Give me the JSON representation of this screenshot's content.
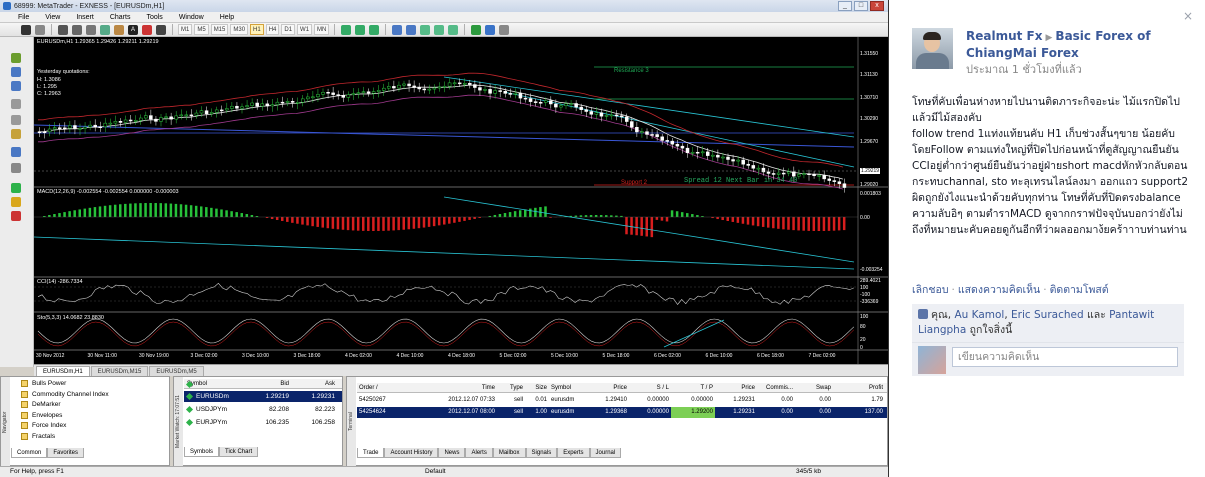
{
  "mt": {
    "title": "68999: MetaTrader - EXNESS - [EURUSDm,H1]",
    "menu": [
      "File",
      "View",
      "Insert",
      "Charts",
      "Tools",
      "Window",
      "Help"
    ],
    "timeframes": [
      "M1",
      "M5",
      "M15",
      "M30",
      "H1",
      "H4",
      "D1",
      "W1",
      "MN"
    ],
    "active_timeframe": "H1",
    "chart": {
      "header": "EURUSDm,H1  1.29365 1.29426 1.29211 1.29219",
      "yesterday": [
        "Yesterday quotations:",
        "H: 1.3086",
        "L: 1.295",
        "C: 1.2963"
      ],
      "price_labels": [
        "1.31550",
        "1.31130",
        "1.30710",
        "1.30290",
        "1.29670",
        "1.29219",
        "1.29020"
      ],
      "current_price": "1.29219",
      "labels": {
        "resistance": "Resistance 3",
        "support": "Support 2",
        "spread": "Spread  12  Next Bar in 34 40"
      },
      "macd_header": "MACD(12,26,9) -0.002554 -0.002554 0.000000 -0.000003",
      "macd_labels": [
        "0.001803",
        "0.00",
        "-0.003254"
      ],
      "cci_header": "CCI(14) -286.7334",
      "cci_labels": [
        "289.4021",
        "100",
        "-100",
        "-336369"
      ],
      "sto_header": "Sto(5,3,3) 14.0682 23.8830",
      "sto_labels": [
        "100",
        "80",
        "20",
        "0"
      ],
      "x_labels": [
        "30 Nov 2012",
        "30 Nov 11:00",
        "30 Nov 19:00",
        "3 Dec 02:00",
        "3 Dec 10:00",
        "3 Dec 18:00",
        "4 Dec 02:00",
        "4 Dec 10:00",
        "4 Dec 18:00",
        "5 Dec 02:00",
        "5 Dec 10:00",
        "5 Dec 18:00",
        "6 Dec 02:00",
        "6 Dec 10:00",
        "6 Dec 18:00",
        "7 Dec 02:00"
      ]
    },
    "chart_tabs": [
      "EURUSDm,H1",
      "EURUSDm,M15",
      "EURUSDm,M5"
    ],
    "navigator": {
      "label": "Navigator",
      "items": [
        "Bulls Power",
        "Commodity Channel Index",
        "DeMarker",
        "Envelopes",
        "Force Index",
        "Fractals"
      ],
      "tabs": [
        "Common",
        "Favorites"
      ]
    },
    "market_watch": {
      "label": "Market Watch: 17:07:51",
      "columns": [
        "Symbol",
        "Bid",
        "Ask"
      ],
      "rows": [
        {
          "symbol": "EURUSDm",
          "bid": "1.29219",
          "ask": "1.29231"
        },
        {
          "symbol": "USDJPYm",
          "bid": "82.208",
          "ask": "82.223"
        },
        {
          "symbol": "EURJPYm",
          "bid": "106.235",
          "ask": "106.258"
        }
      ],
      "tabs": [
        "Symbols",
        "Tick Chart"
      ]
    },
    "terminal": {
      "label": "Terminal",
      "columns": [
        "Order  /",
        "Time",
        "Type",
        "Size",
        "Symbol",
        "Price",
        "S / L",
        "T / P",
        "Price",
        "Commis...",
        "Swap",
        "Profit"
      ],
      "rows": [
        {
          "order": "54250267",
          "time": "2012.12.07 07:33",
          "type": "sell",
          "size": "0.01",
          "symbol": "eurusdm",
          "price": "1.29410",
          "sl": "0.00000",
          "tp": "0.00000",
          "cprice": "1.29231",
          "comm": "0.00",
          "swap": "0.00",
          "profit": "1.79"
        },
        {
          "order": "54254624",
          "time": "2012.12.07 08:00",
          "type": "sell",
          "size": "1.00",
          "symbol": "eurusdm",
          "price": "1.29368",
          "sl": "0.00000",
          "tp": "1.29200",
          "cprice": "1.29231",
          "comm": "0.00",
          "swap": "0.00",
          "profit": "137.00"
        }
      ],
      "tabs": [
        "Trade",
        "Account History",
        "News",
        "Alerts",
        "Mailbox",
        "Signals",
        "Experts",
        "Journal"
      ]
    },
    "status": {
      "help": "For Help, press F1",
      "profile": "Default",
      "traffic": "345/5 kb"
    }
  },
  "fb": {
    "close": "×",
    "author": "Realmut Fx",
    "group": "Basic Forex of ChiangMai Forex",
    "time": "ประมาณ 1 ชั่วโมงที่แล้ว",
    "post": "โทษที่คับเพื่อนห่างหายไปนานติดภาระกิจอะน่ะ ไม้แรกปิดไปแล้วมีไม้สองคับ\nfollow trend 1แท่งแท้ยนคับ H1 เก็บช่วงสั้นๆขาย น้อยคับ โดยFollow ตามแท่งใหญ่ที่ปิดไปก่อนหน้าที่ดูสัญญาณยืนยัน CCIอยู่ต่ำกว่าศูนย์ยืนยันว่าอยู่ฝ่ายshort macdหักหัวกลับตอนกระทบchannal, sto ทะลุเทรนไลน์ลงมา ออกแถว support2 ผิดถูกยังไงแนะนำด้วยคับทุกท่าน โทษที่คับที่ปิดตรงbalance ความลับอิๆ ตามตำราMACD ดูจากกราฟปัจจุบันบอกว่ายังไม่ถึงที่หมายนะคับคอยดูกันอีกทีว่าผลออกมาง้ยคร้าาาบท่านท่าน",
    "actions": [
      "เลิกชอบ",
      "แสดงความคิดเห็น",
      "ติดตามโพสต์"
    ],
    "likes": {
      "prefix": "คุณ,",
      "names": [
        "Au Kamol",
        "Eric Surached"
      ],
      "and": "และ",
      "last": "Pantawit Liangpha",
      "suffix": "ถูกใจสิ่งนี้"
    },
    "comment_placeholder": "เขียนความคิดเห็น"
  }
}
